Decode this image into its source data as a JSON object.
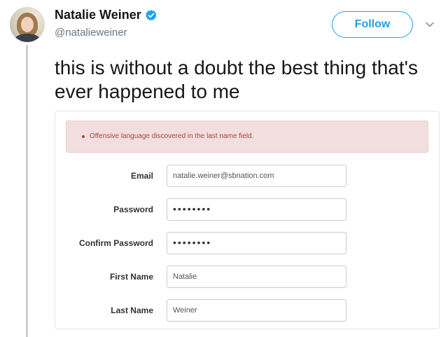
{
  "tweet": {
    "author": {
      "display_name": "Natalie Weiner",
      "handle": "@natalieweiner",
      "verified": true
    },
    "follow_label": "Follow",
    "text": "this is without a doubt the best thing that's ever happened to me",
    "accent_color": "#1da1f2"
  },
  "media": {
    "alert": {
      "message": "Offensive language discovered in the last name field.",
      "background_color": "#f2dede",
      "text_color": "#a94442"
    },
    "form": {
      "fields": [
        {
          "label": "Email",
          "value": "natalie.weiner@sbnation.com"
        },
        {
          "label": "Password",
          "value": "••••••••"
        },
        {
          "label": "Confirm Password",
          "value": "••••••••"
        },
        {
          "label": "First Name",
          "value": "Natalie"
        },
        {
          "label": "Last Name",
          "value": "Weiner"
        }
      ]
    }
  }
}
